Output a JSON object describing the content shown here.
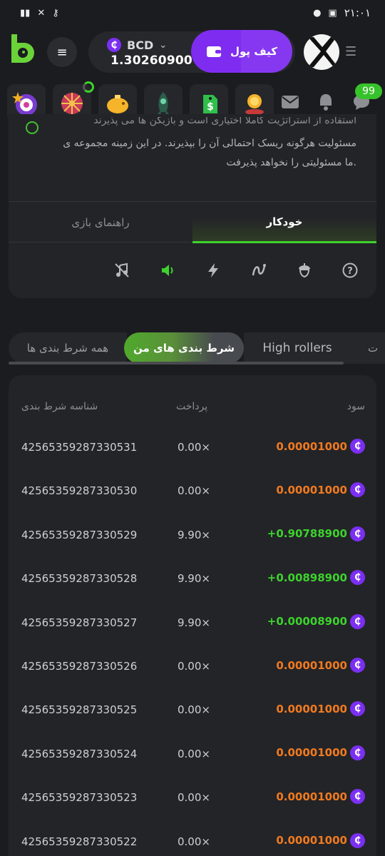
{
  "status_bar": {
    "time": "۲۱:۰۱"
  },
  "header": {
    "menu_icon": "menu-icon",
    "currency": "BCD",
    "coin_symbol": "₵",
    "balance": "1.30260900",
    "wallet_label": "کیف پول",
    "brand_color": "#7f2cf1",
    "accent_green": "#3dd22d"
  },
  "icons_row": {
    "badge": "99"
  },
  "info": {
    "line1": "استفاده از استراتژیت کاملا اختیاری است و بازیکن ها می پذیرند",
    "line2": "مسئولیت هرگونه ریسک احتمالی آن را بپذیرند. در این زمینه مجموعه ی",
    "line3": ".ما مسئولیتی را نخواهد پذیرفت"
  },
  "mode_tabs": {
    "auto": "خودکار",
    "guide": "راهنمای بازی"
  },
  "filters": {
    "all": "همه شرط بندی ها",
    "mine": "شرط بندی های من",
    "high": "High rollers",
    "more": "ت"
  },
  "table": {
    "headers": {
      "id": "شناسه شرط بندی",
      "payout": "پرداخت",
      "profit": "سود"
    },
    "rows": [
      {
        "id": "42565359287330531",
        "payout": "0.00×",
        "profit": "0.00001000",
        "sign": "loss"
      },
      {
        "id": "42565359287330530",
        "payout": "0.00×",
        "profit": "0.00001000",
        "sign": "loss"
      },
      {
        "id": "42565359287330529",
        "payout": "9.90×",
        "profit": "+0.90788900",
        "sign": "win"
      },
      {
        "id": "42565359287330528",
        "payout": "9.90×",
        "profit": "+0.00898900",
        "sign": "win"
      },
      {
        "id": "42565359287330527",
        "payout": "9.90×",
        "profit": "+0.00008900",
        "sign": "win"
      },
      {
        "id": "42565359287330526",
        "payout": "0.00×",
        "profit": "0.00001000",
        "sign": "loss"
      },
      {
        "id": "42565359287330525",
        "payout": "0.00×",
        "profit": "0.00001000",
        "sign": "loss"
      },
      {
        "id": "42565359287330524",
        "payout": "0.00×",
        "profit": "0.00001000",
        "sign": "loss"
      },
      {
        "id": "42565359287330523",
        "payout": "0.00×",
        "profit": "0.00001000",
        "sign": "loss"
      },
      {
        "id": "42565359287330522",
        "payout": "0.00×",
        "profit": "0.00001000",
        "sign": "loss"
      }
    ],
    "win_color": "#3dd22d",
    "loss_color": "#f07a1f"
  }
}
